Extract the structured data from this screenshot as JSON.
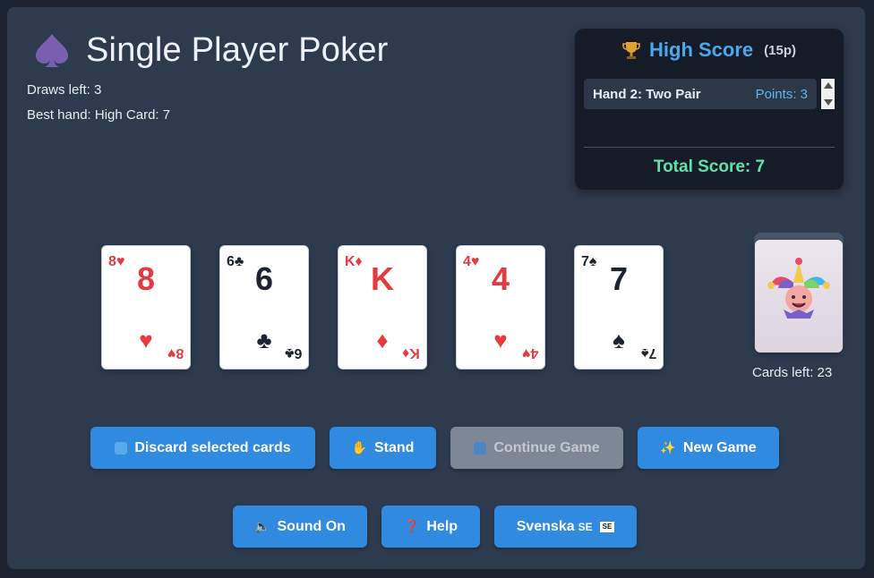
{
  "app": {
    "title": "Single Player Poker",
    "draws_left": "Draws left: 3",
    "best_hand": "Best hand: High Card: 7"
  },
  "high_score": {
    "title": "High Score",
    "subtitle": "(15p)",
    "entries": [
      {
        "hand": "Hand 2: Two Pair",
        "points": "Points: 3"
      }
    ],
    "total": "Total Score: 7"
  },
  "cards": [
    {
      "corner": "8♥",
      "rank": "8",
      "suit": "♥",
      "color": "red"
    },
    {
      "corner": "6♣",
      "rank": "6",
      "suit": "♣",
      "color": "black"
    },
    {
      "corner": "K♦",
      "rank": "K",
      "suit": "♦",
      "color": "red"
    },
    {
      "corner": "4♥",
      "rank": "4",
      "suit": "♥",
      "color": "red"
    },
    {
      "corner": "7♠",
      "rank": "7",
      "suit": "♠",
      "color": "black"
    }
  ],
  "deck": {
    "cards_left": "Cards left: 23",
    "icon": "jester-icon"
  },
  "buttons": {
    "discard": "Discard selected cards",
    "stand": "Stand",
    "continue": "Continue Game",
    "new_game": "New Game",
    "sound": "Sound On",
    "help": "Help",
    "language": "Svenska",
    "language_code": "SE",
    "language_flag": "SE"
  },
  "icons": {
    "discard": "refresh-icon",
    "stand": "hand-icon",
    "continue": "play-icon",
    "new_game": "sparkles-icon",
    "sound": "speaker-icon",
    "help": "question-icon",
    "title": "spade-icon",
    "high_score": "trophy-icon"
  },
  "colors": {
    "accent": "#2f8ae0",
    "score_title": "#4aa8ef",
    "total_score": "#5fe3a8",
    "red_suit": "#e53a3f",
    "disabled": "#7e8796"
  }
}
